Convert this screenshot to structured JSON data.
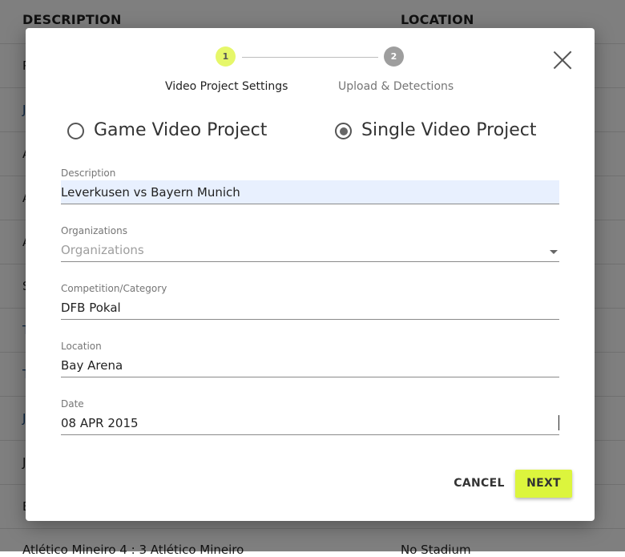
{
  "background_table": {
    "columns": [
      "DESCRIPTION",
      "LOCATION"
    ],
    "row_initials": [
      "P",
      "J",
      "A",
      "A",
      "A",
      "S",
      "T",
      "T",
      "J",
      "J",
      "E"
    ],
    "row_colors": [
      "#222222",
      "#1a4e8a",
      "#222222",
      "#222222",
      "#222222",
      "#222222",
      "#1a4e8a",
      "#1a4e8a",
      "#1a4e8a",
      "#222222",
      "#222222"
    ],
    "last_row": {
      "description": "Atlético Mineiro  4 : 3  Atlético Mineiro",
      "location": "No Stadium"
    }
  },
  "dialog": {
    "steps": [
      {
        "number": "1",
        "label": "Video Project Settings",
        "state": "active",
        "color": "#e6f76a"
      },
      {
        "number": "2",
        "label": "Upload & Detections",
        "state": "inactive",
        "color": "#9e9e9e"
      }
    ],
    "project_type": {
      "options": [
        "Game Video Project",
        "Single Video Project"
      ],
      "selected": "Single Video Project"
    },
    "fields": {
      "description": {
        "label": "Description",
        "value": "Leverkusen vs Bayern Munich"
      },
      "organizations": {
        "label": "Organizations",
        "placeholder": "Organizations",
        "value": ""
      },
      "competition": {
        "label": "Competition/Category",
        "value": "DFB Pokal"
      },
      "location": {
        "label": "Location",
        "value": "Bay Arena"
      },
      "date": {
        "label": "Date",
        "value": "08 APR 2015"
      }
    },
    "buttons": {
      "cancel": "CANCEL",
      "next": "NEXT"
    },
    "accent_color": "#dcf53d",
    "close_icon": "close-icon"
  }
}
